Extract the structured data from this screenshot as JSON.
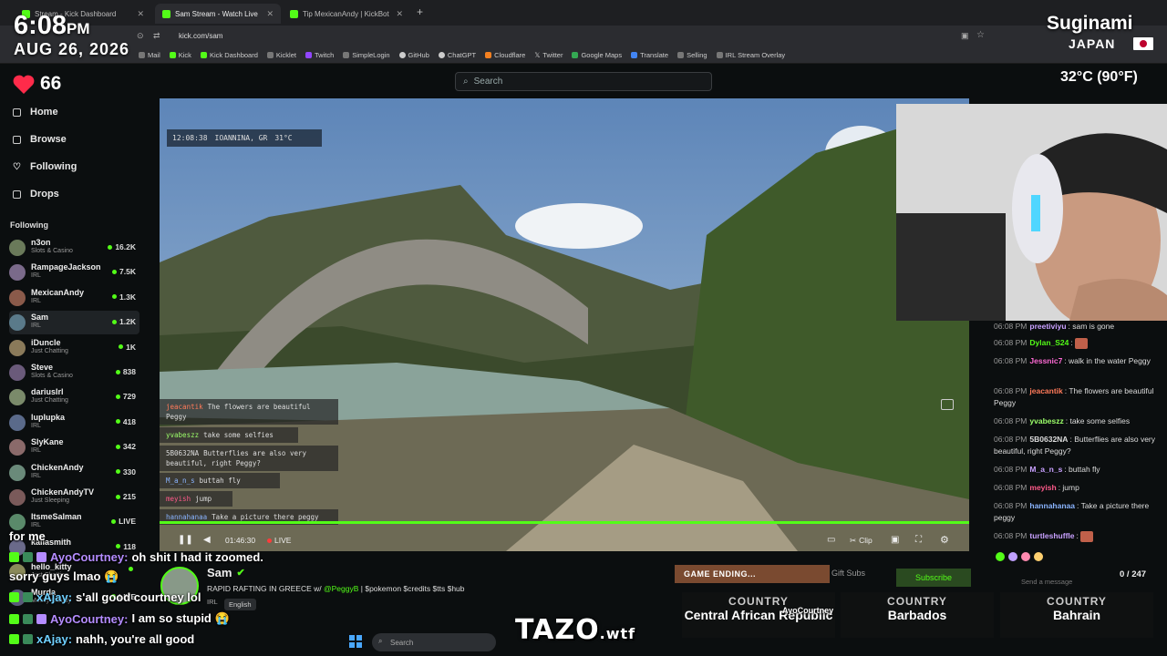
{
  "browser": {
    "tabs": [
      {
        "label": "Stream - Kick Dashboard"
      },
      {
        "label": "Sam Stream - Watch Live o"
      },
      {
        "label": "Tip MexicanAndy | KickBot"
      }
    ],
    "url": "kick.com/sam",
    "bookmarks": [
      "Mail",
      "Kick",
      "Kick Dashboard",
      "Kicklet",
      "Twitch",
      "SimpleLogin",
      "GitHub",
      "ChatGPT",
      "Cloudflare",
      "Twitter",
      "Google Maps",
      "Translate",
      "Selling",
      "IRL Stream Overlay"
    ]
  },
  "overlay": {
    "time": "6:08",
    "ampm": "PM",
    "date": "AUG 26, 2026",
    "hearts": "66",
    "city": "Suginami",
    "country": "JAPAN",
    "temperature": "32°C (90°F)"
  },
  "search": {
    "placeholder": "Search"
  },
  "nav": [
    {
      "label": "Home",
      "icon": "home-icon"
    },
    {
      "label": "Browse",
      "icon": "browse-icon"
    },
    {
      "label": "Following",
      "icon": "heart-icon"
    },
    {
      "label": "Drops",
      "icon": "drops-icon"
    }
  ],
  "following": {
    "heading": "Following",
    "channels": [
      {
        "name": "n3on",
        "category": "Slots & Casino",
        "viewers": "16.2K"
      },
      {
        "name": "RampageJackson",
        "category": "IRL",
        "viewers": "7.5K"
      },
      {
        "name": "MexicanAndy",
        "category": "IRL",
        "viewers": "1.3K"
      },
      {
        "name": "Sam",
        "category": "IRL",
        "viewers": "1.2K"
      },
      {
        "name": "iDuncle",
        "category": "Just Chatting",
        "viewers": "1K"
      },
      {
        "name": "Steve",
        "category": "Slots & Casino",
        "viewers": "838"
      },
      {
        "name": "dariusIrl",
        "category": "Just Chatting",
        "viewers": "729"
      },
      {
        "name": "lupIupka",
        "category": "IRL",
        "viewers": "418"
      },
      {
        "name": "SlyKane",
        "category": "IRL",
        "viewers": "342"
      },
      {
        "name": "ChickenAndy",
        "category": "IRL",
        "viewers": "330"
      },
      {
        "name": "ChickenAndyTV",
        "category": "Just Sleeping",
        "viewers": "215"
      },
      {
        "name": "ItsmeSalman",
        "category": "IRL",
        "viewers": "LIVE"
      },
      {
        "name": "kallasmith",
        "category": "",
        "viewers": "118"
      },
      {
        "name": "hello_kitty",
        "category": "Just Chatting",
        "viewers": ""
      },
      {
        "name": "Murda",
        "category": "Mostly Cloudy",
        "viewers": "LIVE"
      }
    ]
  },
  "video": {
    "overlay_time": "12:08:38",
    "overlay_location": "IOANNINA, GR",
    "overlay_temp": "31°C",
    "elapsed": "01:46:30",
    "live_label": "LIVE",
    "clip_label": "Clip",
    "chat_overlay": [
      {
        "user": "jeacantik",
        "text": "The flowers are beautiful Peggy",
        "color": "#ff7a5a"
      },
      {
        "user": "yvabeszz",
        "text": "take some selfies",
        "color": "#9cff6a"
      },
      {
        "user": "5B0632NA",
        "text": "Butterflies are also very beautiful, right Peggy?",
        "color": "#cccccc"
      },
      {
        "user": "M_a_n_s",
        "text": "buttah fly",
        "color": "#8ab4ff"
      },
      {
        "user": "meyish",
        "text": "jump",
        "color": "#ff5a8a"
      },
      {
        "user": "hannahanaa",
        "text": "Take a picture there peggy",
        "color": "#8ab4ff"
      }
    ]
  },
  "stream": {
    "streamer": "Sam",
    "title_prefix": "RAPID RAFTING IN GREECE w/",
    "title_mention": "@PeggyB",
    "title_suffix": "| $pokemon $credits $tts $hub",
    "category": "IRL",
    "language": "English"
  },
  "chat": {
    "messages": [
      {
        "time": "06:08 PM",
        "user": "preetiviyu",
        "text": "sam is gone",
        "color": "#c8a0ff"
      },
      {
        "time": "06:08 PM",
        "user": "Dylan_S24",
        "text": "",
        "color": "#53fc18"
      },
      {
        "time": "06:08 PM",
        "user": "Jessnic7",
        "text": "walk in the water Peggy",
        "color": "#ff6ad5"
      },
      {
        "time": "06:08 PM",
        "user": "jeacantik",
        "text": "The flowers are beautiful Peggy",
        "color": "#ff7a5a"
      },
      {
        "time": "06:08 PM",
        "user": "yvabeszz",
        "text": "take some selfies",
        "color": "#9cff6a"
      },
      {
        "time": "06:08 PM",
        "user": "5B0632NA",
        "text": "Butterflies are also very beautiful, right Peggy?",
        "color": "#dddddd"
      },
      {
        "time": "06:08 PM",
        "user": "M_a_n_s",
        "text": "buttah fly",
        "color": "#c8a0ff"
      },
      {
        "time": "06:08 PM",
        "user": "meyish",
        "text": "jump",
        "color": "#ff5a8a"
      },
      {
        "time": "06:08 PM",
        "user": "hannahanaa",
        "text": "Take a picture there peggy",
        "color": "#8ab4ff"
      },
      {
        "time": "06:08 PM",
        "user": "turtleshuffle",
        "text": "",
        "color": "#c8a0ff"
      }
    ],
    "count": "0 / 247",
    "input_placeholder": "Send a message",
    "gift_subs": "Gift Subs",
    "subscribe": "Subscribe"
  },
  "game": {
    "status": "GAME ENDING...",
    "countries": [
      {
        "label": "COUNTRY",
        "value": "Central African Republic"
      },
      {
        "label": "COUNTRY",
        "value": "Barbados"
      },
      {
        "label": "COUNTRY",
        "value": "Bahrain"
      }
    ],
    "player_tag": "AyoCourtney"
  },
  "overlay_chat": [
    {
      "user": "",
      "text": "for me"
    },
    {
      "user": "AyoCourtney:",
      "text": "oh shit I had it zoomed."
    },
    {
      "user": "",
      "text": "sorry guys lmao 😭"
    },
    {
      "user": "xAjay:",
      "text": "s'all good courtney lol"
    },
    {
      "user": "AyoCourtney:",
      "text": "I am so stupid 😭"
    },
    {
      "user": "xAjay:",
      "text": "nahh, you're all good"
    }
  ],
  "taskbar": {
    "search": "Search"
  },
  "watermark": {
    "main": "TAZO",
    "suffix": ".wtf"
  }
}
